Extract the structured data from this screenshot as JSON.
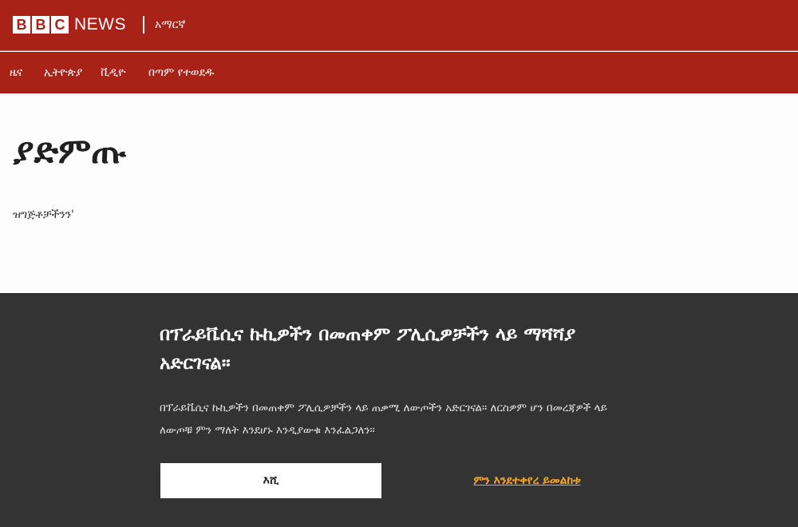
{
  "header": {
    "brand_blocks": [
      "B",
      "B",
      "C"
    ],
    "brand_news": "NEWS",
    "language_name": "አማርኛ",
    "brand_color": "#a82218"
  },
  "nav": {
    "items": [
      {
        "label": "ዜና"
      },
      {
        "label": "ኢትዮጵያ"
      },
      {
        "label": "ቪዲዮ"
      },
      {
        "label": "በጣም የተወደዱ"
      }
    ]
  },
  "main": {
    "title": "ያድምጡ",
    "body": "ዝግጅቶቻችንን'"
  },
  "consent": {
    "title": "በፕራይቬሲና ኩኪዎችን በመጠቀም ፖሊሲዎቻችን ላይ ማሻሻያ አድርገናል።",
    "text": "በፕራይቬሲና ኩኪዎችን በመጠቀም ፖሊሲዎቻችን ላይ ጠቃሚ ለውጦችን አድርገናል። ለርስዎም ሆን በመረጃዎች ላይ ለውጦቹ ምን ማለት እንደሆኑ እንዲያውቁ እንፈልጋለን።",
    "ok_label": "እሺ",
    "link_label": "ምን እንደተቀየረ ይመልከቱ",
    "background_color": "#333333",
    "link_color": "#f5a623"
  }
}
